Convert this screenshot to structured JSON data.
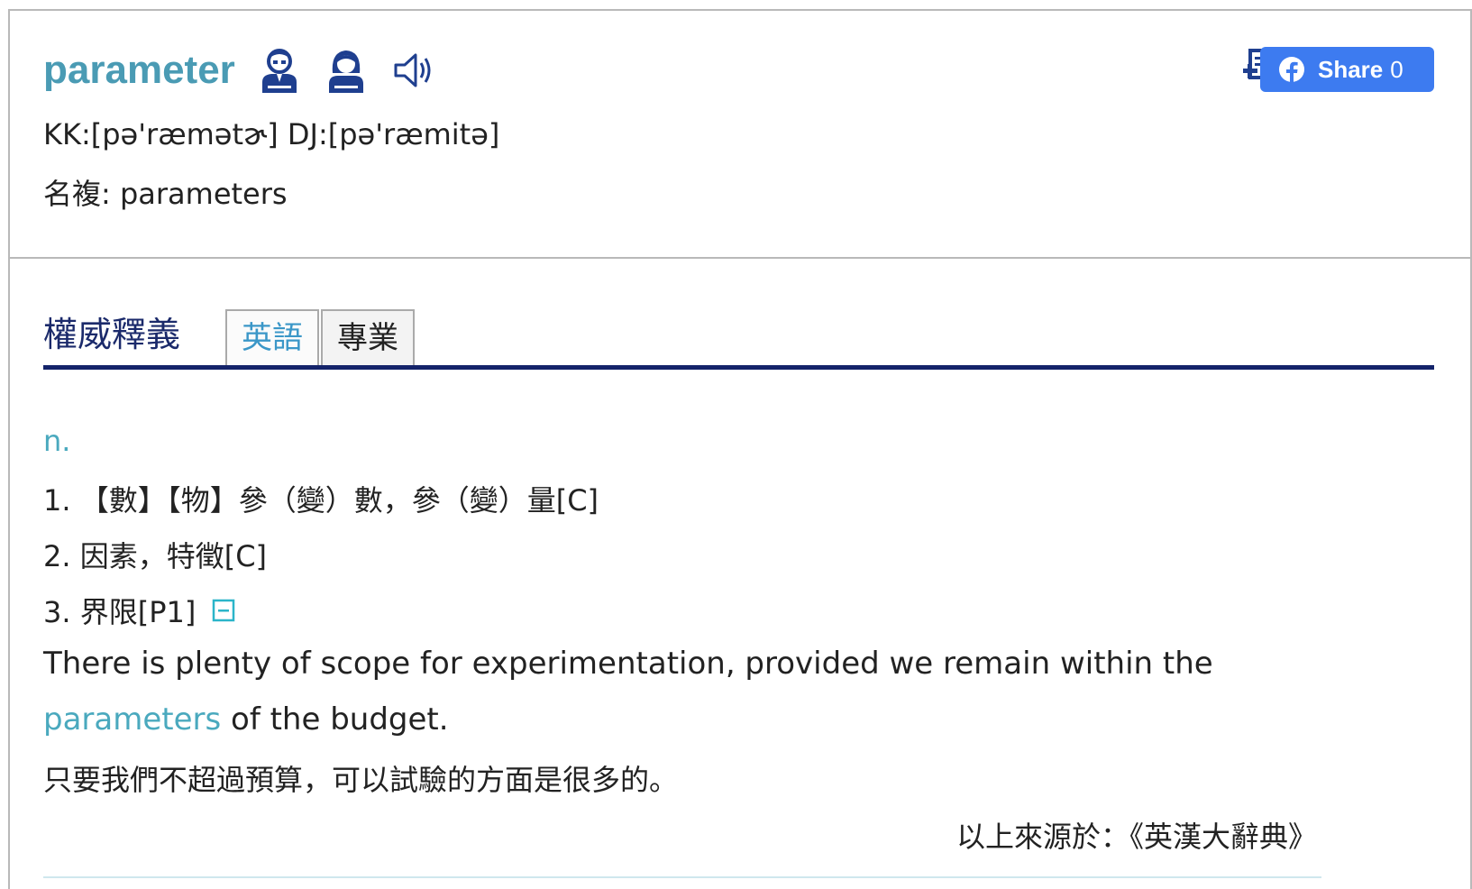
{
  "entry": {
    "headword": "parameter",
    "pronunciation": "KK:[pə'ræmətɚ] DJ:[pə'ræmitə]",
    "plural_line": "名複: parameters",
    "icons": [
      "male-speaker-icon",
      "female-speaker-icon",
      "sound-icon"
    ]
  },
  "toolbar": {
    "icons": [
      "add-to-wordbook-icon",
      "report-icon",
      "rss-icon"
    ],
    "share_label": "Share",
    "share_count": "0"
  },
  "section": {
    "title": "權威釋義",
    "tabs": [
      {
        "label": "英語",
        "active": true
      },
      {
        "label": "專業",
        "active": false
      }
    ]
  },
  "definition": {
    "part_of_speech": "n.",
    "senses": [
      "1. 【數】【物】參（變）數，參（變）量[C]",
      "2. 因素，特徵[C]",
      "3. 界限[P1]"
    ],
    "example_en_line1": "There is plenty of scope for experimentation, provided we remain within the",
    "example_en_highlight": "parameters",
    "example_en_line2_rest": " of the budget.",
    "example_zh": "只要我們不超過預算，可以試驗的方面是很多的。",
    "source": "以上來源於：《英漢大辭典》"
  },
  "colors": {
    "headword": "#4a9bb4",
    "accent": "#4aa9be",
    "section_rule": "#14236a",
    "share_button": "#3d7bf0"
  }
}
